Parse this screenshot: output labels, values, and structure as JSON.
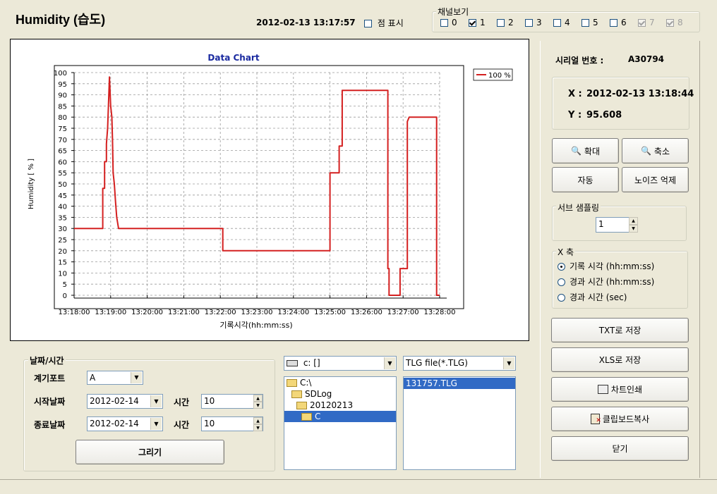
{
  "header": {
    "title": "Humidity  (습도)",
    "datetime": "2012-02-13 13:17:57",
    "point_display_label": "점 표시"
  },
  "channels": {
    "group_label": "채널보기",
    "items": [
      {
        "label": "0",
        "checked": false,
        "enabled": true
      },
      {
        "label": "1",
        "checked": true,
        "enabled": true
      },
      {
        "label": "2",
        "checked": false,
        "enabled": true
      },
      {
        "label": "3",
        "checked": false,
        "enabled": true
      },
      {
        "label": "4",
        "checked": false,
        "enabled": true
      },
      {
        "label": "5",
        "checked": false,
        "enabled": true
      },
      {
        "label": "6",
        "checked": false,
        "enabled": true
      },
      {
        "label": "7",
        "checked": true,
        "enabled": false
      },
      {
        "label": "8",
        "checked": true,
        "enabled": false
      }
    ]
  },
  "chart_data": {
    "type": "line",
    "title": "Data Chart",
    "xlabel": "기록시각(hh:mm:ss)",
    "ylabel": "Humidity [ % ]",
    "ylim": [
      0,
      100
    ],
    "yticks": [
      0,
      5,
      10,
      15,
      20,
      25,
      30,
      35,
      40,
      45,
      50,
      55,
      60,
      65,
      70,
      75,
      80,
      85,
      90,
      95,
      100
    ],
    "xticks": [
      "13:18:00",
      "13:19:00",
      "13:20:00",
      "13:21:00",
      "13:22:00",
      "13:23:00",
      "13:24:00",
      "13:25:00",
      "13:26:00",
      "13:27:00",
      "13:28:00"
    ],
    "grid": true,
    "legend_position": "top-right",
    "series": [
      {
        "name": "100 %",
        "color": "#d42020",
        "points": [
          [
            "13:18:00",
            30
          ],
          [
            "13:18:47",
            30
          ],
          [
            "13:18:47",
            48
          ],
          [
            "13:18:50",
            48
          ],
          [
            "13:18:50",
            60
          ],
          [
            "13:18:53",
            60
          ],
          [
            "13:18:53",
            68
          ],
          [
            "13:18:55",
            75
          ],
          [
            "13:18:57",
            90
          ],
          [
            "13:18:58",
            98
          ],
          [
            "13:18:59",
            92
          ],
          [
            "13:19:00",
            85
          ],
          [
            "13:19:02",
            80
          ],
          [
            "13:19:03",
            70
          ],
          [
            "13:19:04",
            55
          ],
          [
            "13:19:06",
            50
          ],
          [
            "13:19:08",
            42
          ],
          [
            "13:19:10",
            35
          ],
          [
            "13:19:13",
            30
          ],
          [
            "13:22:04",
            30
          ],
          [
            "13:22:04",
            20
          ],
          [
            "13:25:00",
            20
          ],
          [
            "13:25:00",
            55
          ],
          [
            "13:25:15",
            55
          ],
          [
            "13:25:15",
            67
          ],
          [
            "13:25:20",
            67
          ],
          [
            "13:25:20",
            92
          ],
          [
            "13:26:35",
            92
          ],
          [
            "13:26:35",
            12
          ],
          [
            "13:26:37",
            12
          ],
          [
            "13:26:37",
            0
          ],
          [
            "13:26:55",
            0
          ],
          [
            "13:26:55",
            12
          ],
          [
            "13:27:07",
            12
          ],
          [
            "13:27:07",
            78
          ],
          [
            "13:27:10",
            80
          ],
          [
            "13:27:55",
            80
          ],
          [
            "13:27:55",
            0
          ],
          [
            "13:28:00",
            0
          ]
        ]
      }
    ]
  },
  "right_panel": {
    "serial_label": "시리얼 번호 :",
    "serial_value": "A30794",
    "x_label": "X :",
    "x_value": "2012-02-13 13:18:44",
    "y_label": "Y :",
    "y_value": "95.608",
    "zoom_in_label": "확대",
    "zoom_out_label": "축소",
    "auto_label": "자동",
    "noise_label": "노이즈 억제",
    "subsample_group": "서브 샘플링",
    "subsample_value": "1",
    "xaxis_group": "X 축",
    "xaxis_options": [
      {
        "label": "기록 시각 (hh:mm:ss)",
        "selected": true
      },
      {
        "label": "경과 시간 (hh:mm:ss)",
        "selected": false
      },
      {
        "label": "경과 시간 (sec)",
        "selected": false
      }
    ],
    "save_txt": "TXT로 저장",
    "save_xls": "XLS로 저장",
    "print_chart": "차트인쇄",
    "clipboard_copy": "클립보드복사",
    "close": "닫기"
  },
  "datetime_panel": {
    "group_label": "날짜/시간",
    "port_label": "계기포트",
    "port_value": "A",
    "start_label": "시작날짜",
    "start_date": "2012-02-14",
    "start_time_label": "시간",
    "start_time": "10",
    "end_label": "종료날짜",
    "end_date": "2012-02-14",
    "end_time_label": "시간",
    "end_time": "10",
    "draw_label": "그리기"
  },
  "file_browser": {
    "drive_value": "c: []",
    "folders": [
      "C:\\",
      "SDLog",
      "20120213",
      "C"
    ],
    "filter_value": "TLG file(*.TLG)",
    "files": [
      "131757.TLG"
    ]
  }
}
